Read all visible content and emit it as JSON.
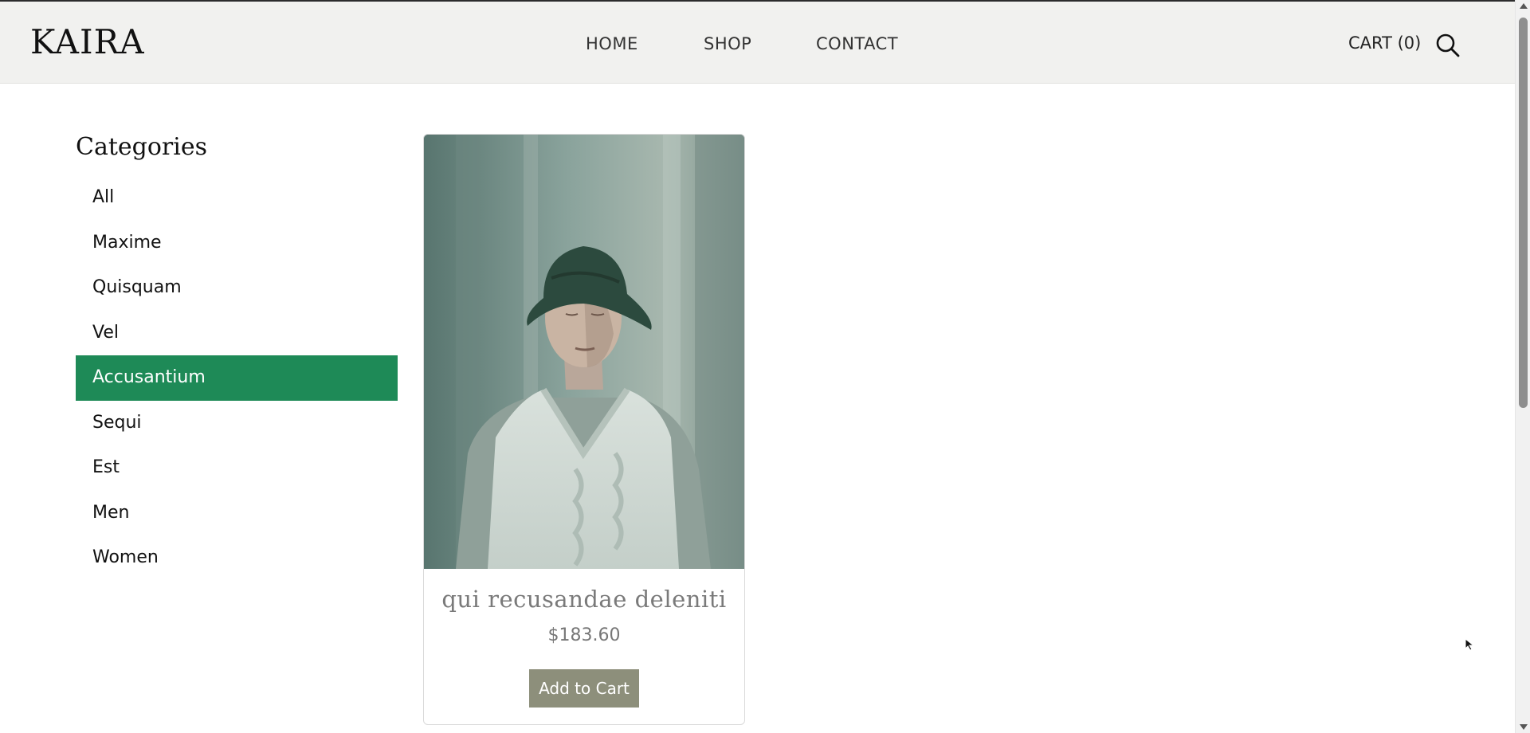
{
  "header": {
    "logo": "KAIRA",
    "nav": [
      {
        "label": "HOME"
      },
      {
        "label": "SHOP"
      },
      {
        "label": "CONTACT"
      }
    ],
    "cart_label": "CART (0)",
    "search_icon": "search-icon"
  },
  "sidebar": {
    "title": "Categories",
    "items": [
      {
        "label": "All",
        "active": false
      },
      {
        "label": "Maxime",
        "active": false
      },
      {
        "label": "Quisquam",
        "active": false
      },
      {
        "label": "Vel",
        "active": false
      },
      {
        "label": "Accusantium",
        "active": true
      },
      {
        "label": "Sequi",
        "active": false
      },
      {
        "label": "Est",
        "active": false
      },
      {
        "label": "Men",
        "active": false
      },
      {
        "label": "Women",
        "active": false
      }
    ]
  },
  "products": [
    {
      "name": "qui recusandae deleniti",
      "price": "$183.60",
      "button_label": "Add to Cart"
    }
  ],
  "colors": {
    "active_category": "#1e8a57",
    "add_button": "#8d8f7b",
    "header_bg": "#f1f1ef"
  }
}
